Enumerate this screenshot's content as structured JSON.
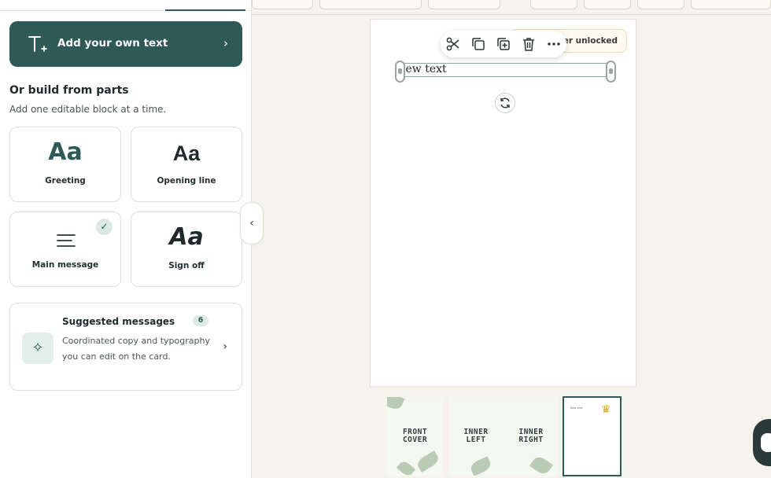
{
  "panel": {
    "add_text_label": "Add your own text",
    "section_title": "Or build from parts",
    "section_sub": "Add one editable block at a time.",
    "parts": [
      {
        "preview": "Aa",
        "caption": "Greeting"
      },
      {
        "preview": "Aa",
        "caption": "Opening line"
      },
      {
        "caption": "Main message"
      },
      {
        "preview": "Aa",
        "caption": "Sign off"
      }
    ],
    "suggested": {
      "title": "Suggested messages",
      "count": "6",
      "description": "Coordinated copy and typography you can edit on the card."
    }
  },
  "canvas": {
    "unlock_text": "ver unlocked",
    "text_value": "New text",
    "text_visible": "lew text"
  },
  "thumbnails": [
    {
      "label_lines": [
        "FRONT",
        "COVER"
      ]
    },
    {
      "label_lines": [
        "INNER",
        "LEFT"
      ]
    },
    {
      "label_lines": [
        "INNER",
        "RIGHT"
      ]
    },
    {
      "mini_text": "New text"
    }
  ],
  "colors": {
    "accent": "#2e5956",
    "canvas_bg": "#f6f2ec",
    "check_bg": "#dbe9e4",
    "crown": "#d4a63a"
  },
  "icons": {
    "add_text": "text-plus-icon",
    "cut": "scissors-icon",
    "copy": "copy-icon",
    "duplicate": "duplicate-plus-icon",
    "delete": "trash-icon",
    "more": "more-horizontal-icon",
    "rotate": "rotate-icon",
    "sparkle": "sparkle-icon",
    "crown": "crown-icon"
  }
}
